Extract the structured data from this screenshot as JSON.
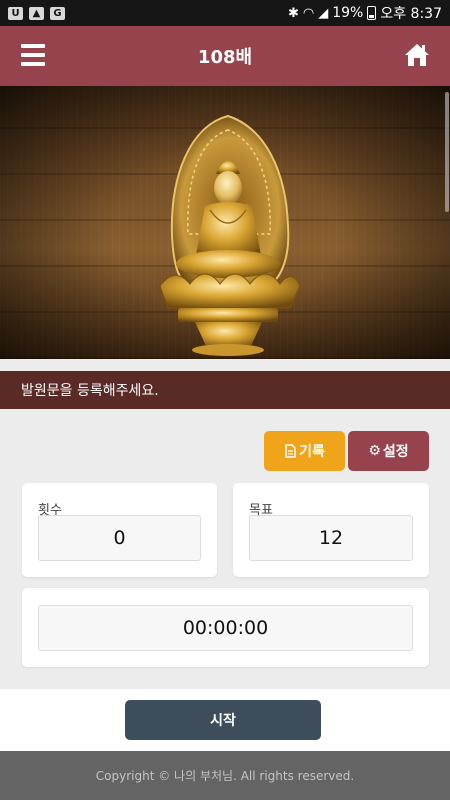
{
  "status_bar": {
    "left_icons": [
      "u-plus-icon",
      "gallery-icon",
      "g-icon"
    ],
    "battery": "19%",
    "time": "오후 8:37"
  },
  "app_bar": {
    "title": "108배"
  },
  "prayer": {
    "text": "발원문을 등록해주세요."
  },
  "actions": {
    "record_label": "기록",
    "settings_label": "설정"
  },
  "counter": {
    "count_label": "횟수",
    "count_value": "0",
    "goal_label": "목표",
    "goal_value": "12",
    "timer": "00:00:00"
  },
  "start": {
    "label": "시작"
  },
  "footer": {
    "copyright": "Copyright © 나의 부처님. All rights reserved."
  },
  "colors": {
    "header": "#96434d",
    "prayer_bar": "#5a2b26",
    "record_button": "#f0a41a",
    "settings_button": "#96434d",
    "start_button": "#3e4d5b",
    "footer": "#646464"
  }
}
